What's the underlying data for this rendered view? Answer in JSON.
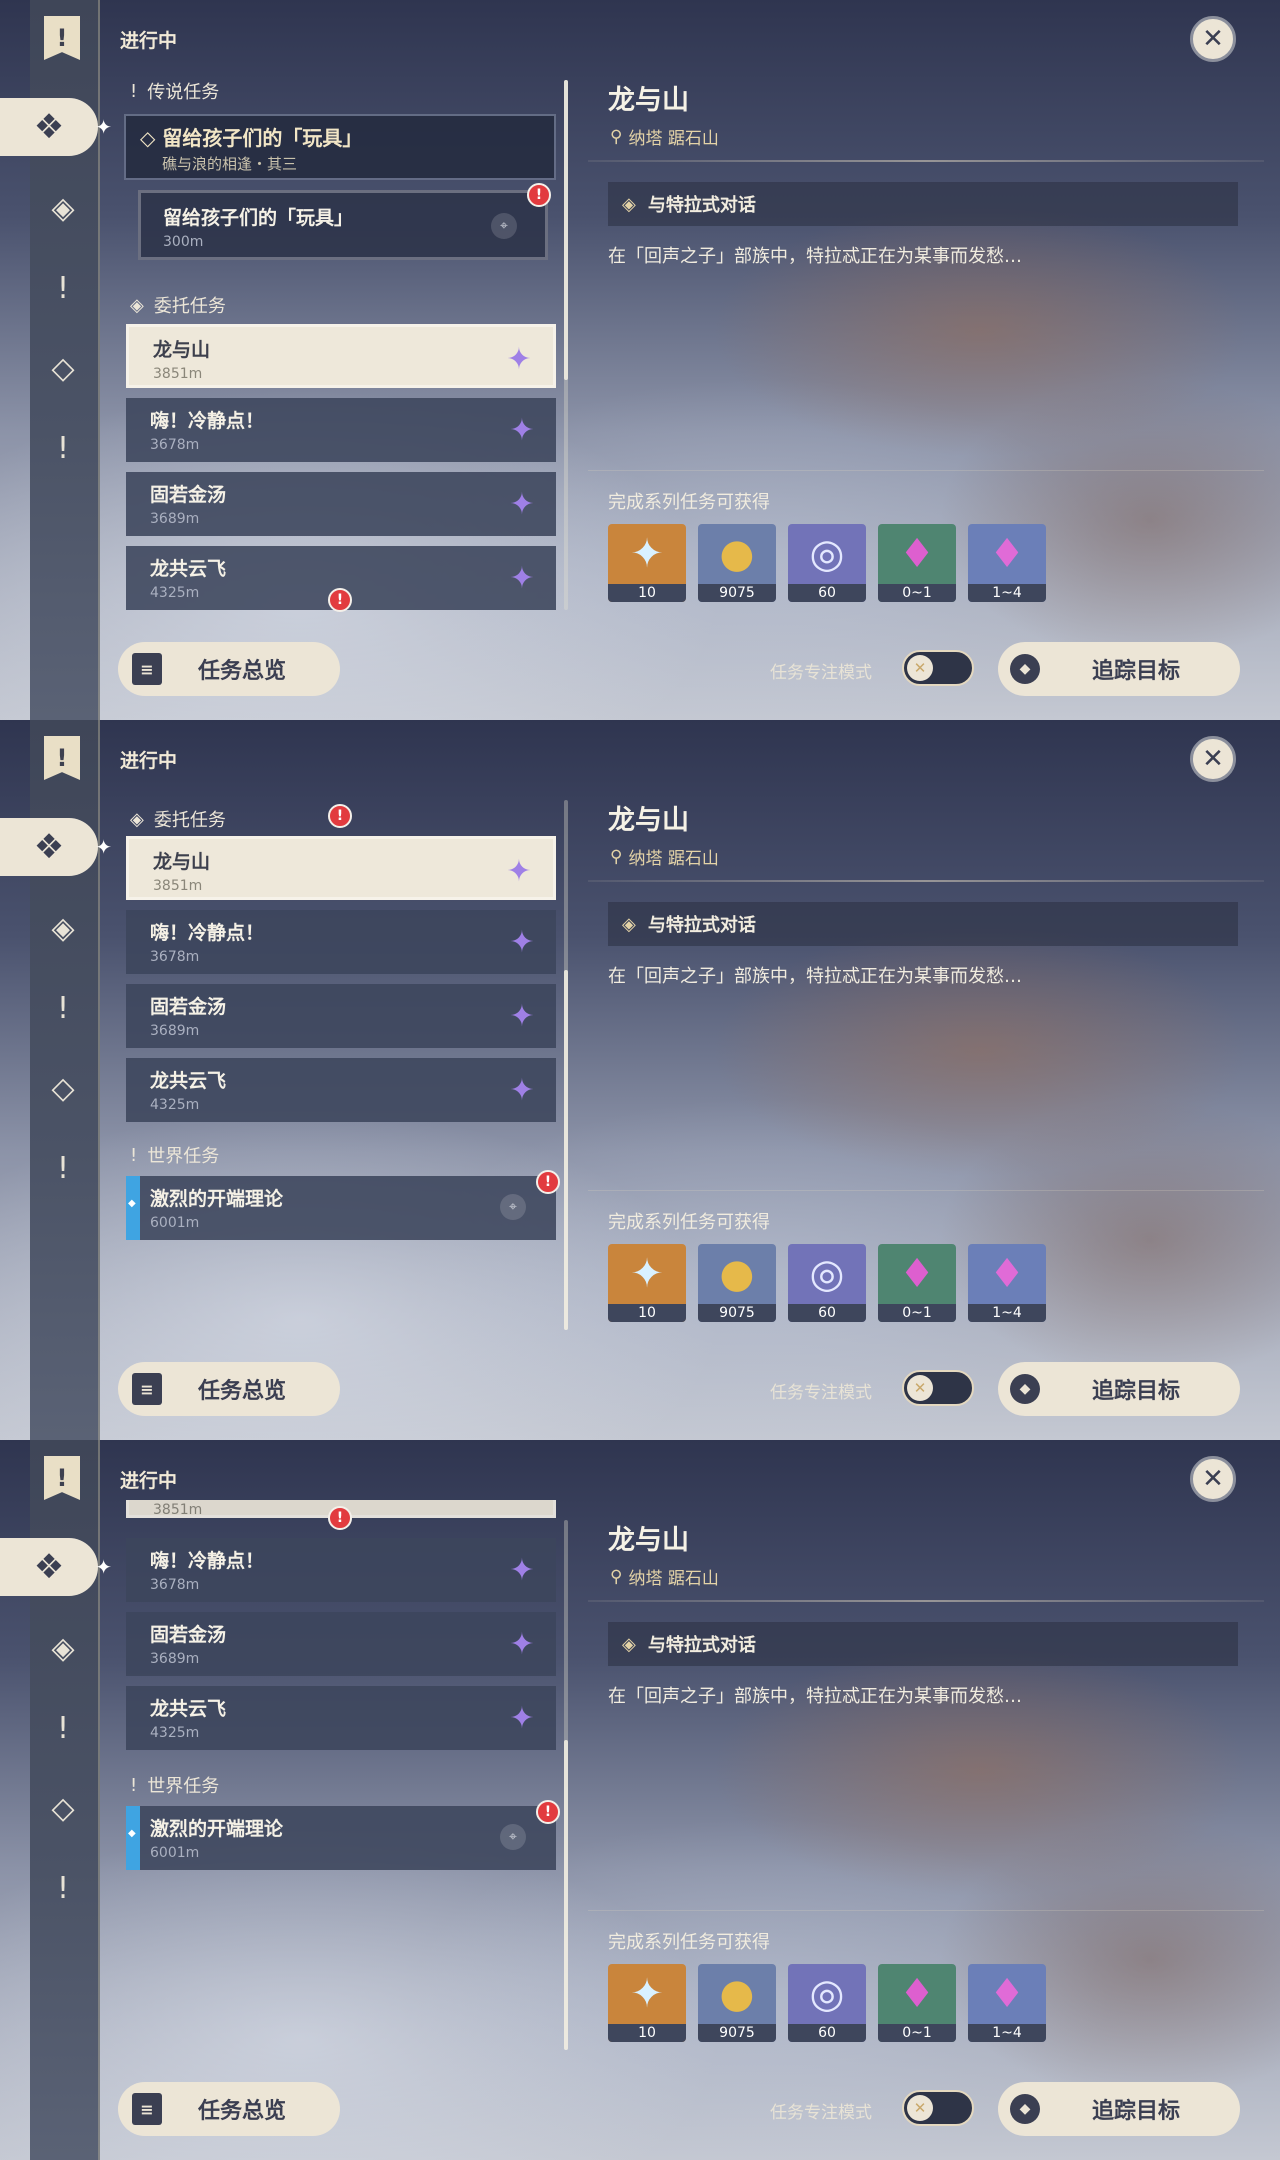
{
  "header": {
    "in_progress_label": "进行中"
  },
  "close": {
    "icon": "close-icon",
    "glyph": "✕"
  },
  "rail": {
    "bookmark_glyph": "!",
    "active_glyph": "❖",
    "icons": [
      {
        "name": "archon-quest-icon",
        "glyph": "❖"
      },
      {
        "name": "legend-quest-icon",
        "glyph": "◈"
      },
      {
        "name": "story-quest-icon",
        "glyph": "!"
      },
      {
        "name": "commission-quest-icon",
        "glyph": "◇"
      },
      {
        "name": "world-quest-icon",
        "glyph": "!"
      }
    ]
  },
  "sections": {
    "legend": "传说任务",
    "commission": "委托任务",
    "world": "世界任务"
  },
  "legend_quest": {
    "title": "留给孩子们的「玩具」",
    "subtitle": "礁与浪的相逢・其三",
    "sub_title": "留给孩子们的「玩具」",
    "sub_distance": "300m"
  },
  "commission_quests": [
    {
      "name": "龙与山",
      "distance": "3851m"
    },
    {
      "name": "嗨！冷静点！",
      "distance": "3678m"
    },
    {
      "name": "固若金汤",
      "distance": "3689m"
    },
    {
      "name": "龙共云飞",
      "distance": "4325m"
    }
  ],
  "world_quest": {
    "name": "激烈的开端理论",
    "distance": "6001m"
  },
  "detail": {
    "title": "龙与山",
    "location": "纳塔 踞石山",
    "objective": "与特拉式对话",
    "description": "在「回声之子」部族中，特拉忒正在为某事而发愁…",
    "rewards_label": "完成系列任务可获得",
    "rewards": [
      {
        "name": "primogem-icon",
        "count": "10",
        "bg": "#c9853c",
        "glyph": "✦",
        "color": "#d9f1ff"
      },
      {
        "name": "mora-icon",
        "count": "9075",
        "bg": "#6c7faa",
        "glyph": "●",
        "color": "#e6b94a"
      },
      {
        "name": "adventure-exp-icon",
        "count": "60",
        "bg": "#7273b8",
        "glyph": "◎",
        "color": "#e4e8ff"
      },
      {
        "name": "crystal-icon",
        "count": "0~1",
        "bg": "#4f8571",
        "glyph": "♦",
        "color": "#dd5fcf"
      },
      {
        "name": "crystal-cluster-icon",
        "count": "1~4",
        "bg": "#6b7fb8",
        "glyph": "♦",
        "color": "#e06bd7"
      }
    ]
  },
  "footer": {
    "overview_label": "任务总览",
    "focus_mode_label": "任务专注模式",
    "track_label": "追踪目标"
  },
  "colors": {
    "accent": "#ece5d6",
    "alert": "#e23b3f",
    "world_bar": "#3fa4e2"
  }
}
